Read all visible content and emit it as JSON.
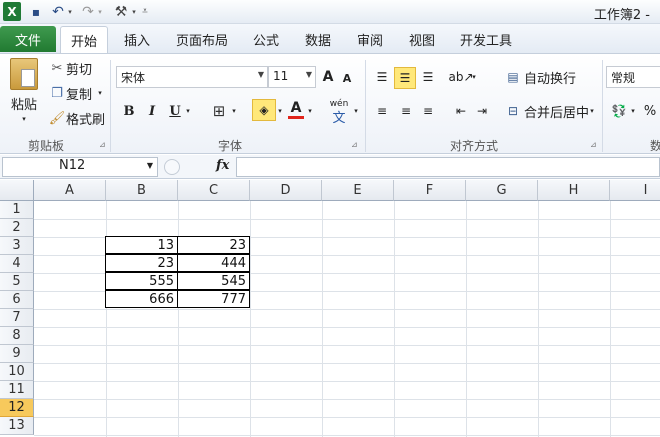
{
  "app": {
    "title": "工作簿2 -"
  },
  "quick_access": {
    "excel": "X",
    "save": "▪",
    "undo": "↶",
    "redo": "↷",
    "more": "⚒",
    "customize": "⩡"
  },
  "tabs": {
    "file": "文件",
    "home": "开始",
    "items": [
      "插入",
      "页面布局",
      "公式",
      "数据",
      "审阅",
      "视图",
      "开发工具"
    ]
  },
  "clipboard": {
    "paste": "粘贴",
    "cut": "剪切",
    "copy": "复制",
    "format_painter": "格式刷",
    "label": "剪贴板"
  },
  "font": {
    "name": "宋体",
    "size": "11",
    "bold": "B",
    "italic": "I",
    "underline": "U",
    "font_color_letter": "A",
    "phonetic": "wén",
    "label": "字体",
    "grow": "A",
    "shrink": "A"
  },
  "alignment": {
    "wrap": "自动换行",
    "merge": "合并后居中",
    "label": "对齐方式"
  },
  "number": {
    "format": "常规",
    "percent": "%",
    "label_partial": "数"
  },
  "formula_bar": {
    "name_box": "N12",
    "fx": "fx",
    "value": ""
  },
  "columns": [
    "A",
    "B",
    "C",
    "D",
    "E",
    "F",
    "G",
    "H",
    "I"
  ],
  "rows": [
    "1",
    "2",
    "3",
    "4",
    "5",
    "6",
    "7",
    "8",
    "9",
    "10",
    "11",
    "12",
    "13"
  ],
  "selected_row": "12",
  "table": {
    "B": [
      "13",
      "23",
      "555",
      "666"
    ],
    "C": [
      "23",
      "444",
      "545",
      "777"
    ]
  },
  "colors": {
    "file_tab": "#2a853a",
    "selected_row": "#f7c95c",
    "highlight": "#ffe87a",
    "font_red": "#e0241b"
  }
}
